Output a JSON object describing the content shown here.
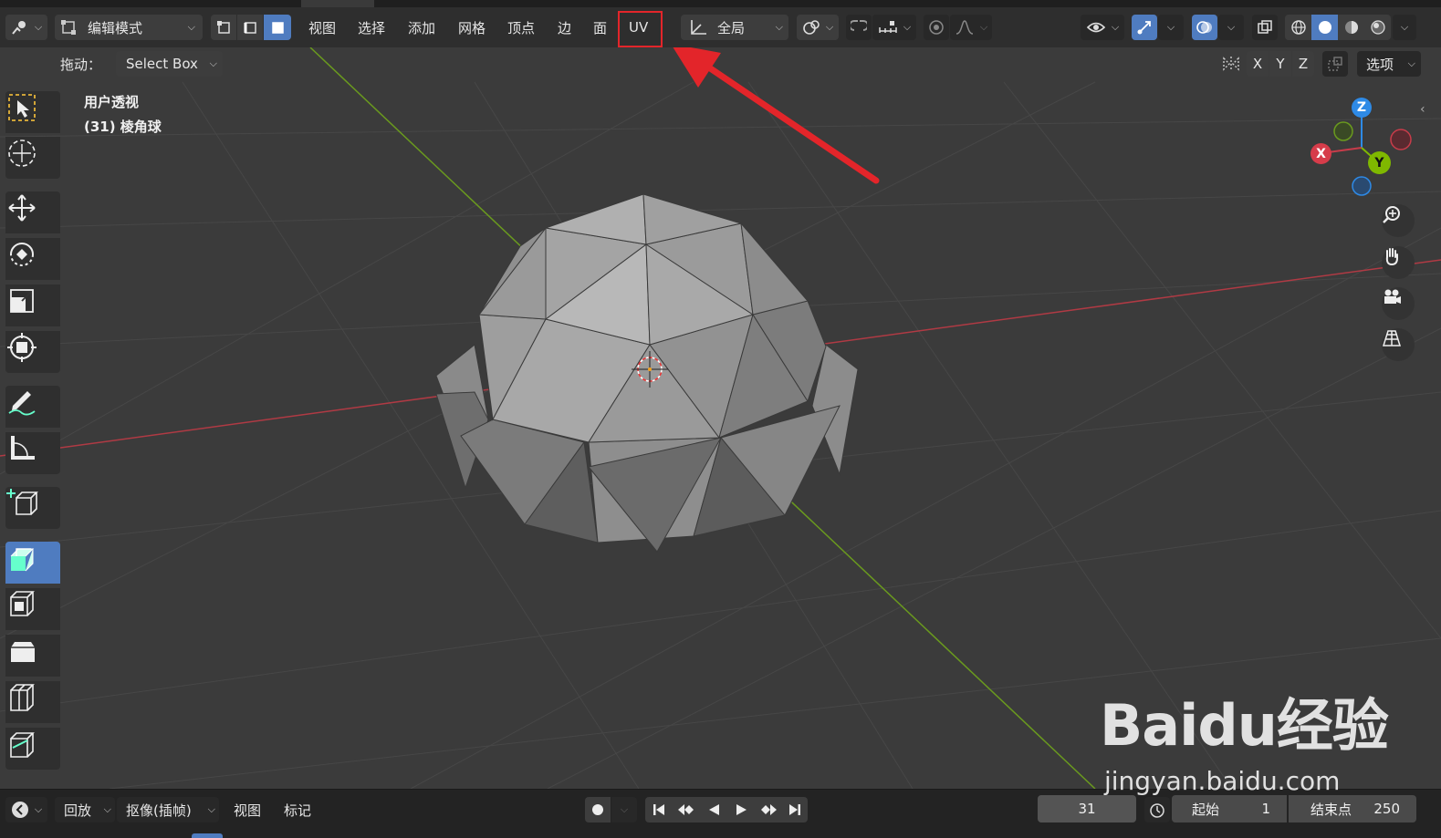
{
  "header": {
    "mode_label": "编辑模式",
    "menus": [
      "视图",
      "选择",
      "添加",
      "网格",
      "顶点",
      "边",
      "面",
      "UV"
    ],
    "transform_orientation": "全局",
    "options_label": "选项",
    "axis_x": "X",
    "axis_y": "Y",
    "axis_z": "Z"
  },
  "tool_settings": {
    "drag_label": "拖动：",
    "drag_value": "Select Box"
  },
  "viewport": {
    "view_name": "用户透视",
    "object_info": "(31) 棱角球",
    "gizmo": {
      "x": "X",
      "y": "Y",
      "z": "Z"
    }
  },
  "timeline": {
    "playback_label": "回放",
    "keying_label": "抠像(插帧)",
    "view_label": "视图",
    "marker_label": "标记",
    "current_frame": "31",
    "start_label": "起始",
    "start_value": "1",
    "end_label": "结束点",
    "end_value": "250"
  },
  "watermark": {
    "brand": "Baidu经验",
    "url": "jingyan.baidu.com"
  },
  "colors": {
    "highlight_box": "#e3252a",
    "arrow": "#e3252a",
    "active_tool": "#4f7cc0",
    "x_axis": "#c83c4a",
    "y_axis": "#7fb800",
    "z_axis": "#2e8ae6"
  }
}
